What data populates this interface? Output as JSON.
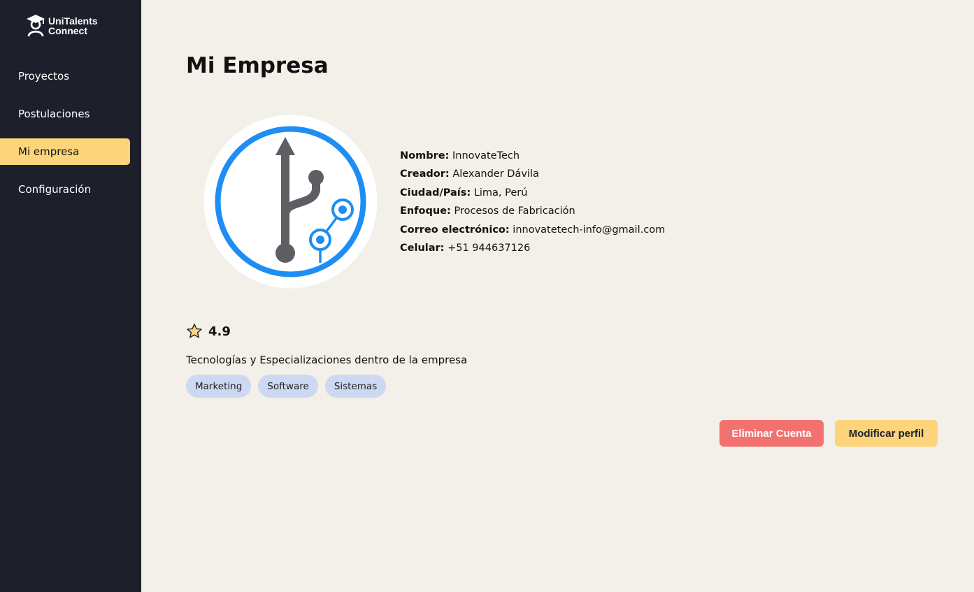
{
  "brand": {
    "line1": "UniTalents",
    "line2": "Connect"
  },
  "sidebar": {
    "items": [
      {
        "label": "Proyectos",
        "active": false
      },
      {
        "label": "Postulaciones",
        "active": false
      },
      {
        "label": "Mi empresa",
        "active": true
      },
      {
        "label": "Configuración",
        "active": false
      }
    ]
  },
  "page": {
    "title": "Mi Empresa"
  },
  "company": {
    "fields": [
      {
        "label": "Nombre:",
        "value": "InnovateTech"
      },
      {
        "label": "Creador:",
        "value": "Alexander Dávila"
      },
      {
        "label": "Ciudad/País:",
        "value": "Lima, Perú"
      },
      {
        "label": "Enfoque:",
        "value": "Procesos de Fabricación"
      },
      {
        "label": "Correo electrónico:",
        "value": "innovatetech-info@gmail.com"
      },
      {
        "label": "Celular:",
        "value": "+51 944637126"
      }
    ],
    "rating": "4.9",
    "tech_title": "Tecnologías y Especializaciones dentro de la empresa",
    "tags": [
      "Marketing",
      "Software",
      "Sistemas"
    ]
  },
  "actions": {
    "delete_label": "Eliminar Cuenta",
    "edit_label": "Modificar perfil"
  },
  "colors": {
    "sidebar_bg": "#1d1f2b",
    "accent": "#fdd47a",
    "danger": "#f3716e",
    "tag_bg": "#cdd8f2",
    "page_bg": "#f3f0ea",
    "logo_blue": "#1e8ef5",
    "logo_gray": "#5f5f63"
  },
  "icons": {
    "brand": "graduate-icon",
    "rating": "star-icon",
    "logo": "git-branch-icon"
  }
}
